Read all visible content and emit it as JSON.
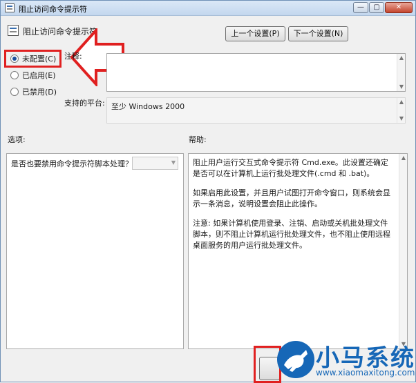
{
  "window": {
    "title": "阻止访问命令提示符"
  },
  "header": {
    "policy_title": "阻止访问命令提示符",
    "prev_button": "上一个设置(P)",
    "next_button": "下一个设置(N)"
  },
  "state": {
    "options": [
      {
        "label": "未配置(C)",
        "checked": true
      },
      {
        "label": "已启用(E)",
        "checked": false
      },
      {
        "label": "已禁用(D)",
        "checked": false
      }
    ]
  },
  "comment": {
    "label": "注释:",
    "value": ""
  },
  "platform": {
    "label": "支持的平台:",
    "value": "至少 Windows 2000"
  },
  "sections": {
    "options_label": "选项:",
    "help_label": "帮助:"
  },
  "options_panel": {
    "question": "是否也要禁用命令提示符脚本处理？",
    "selected": ""
  },
  "help": {
    "paragraphs": [
      "阻止用户运行交互式命令提示符 Cmd.exe。此设置还确定是否可以在计算机上运行批处理文件(.cmd 和 .bat)。",
      "如果启用此设置，并且用户试图打开命令窗口，则系统会显示一条消息，说明设置会阻止此操作。",
      "注意: 如果计算机使用登录、注销、启动或关机批处理文件脚本，则不阻止计算机运行批处理文件，也不阻止使用远程桌面服务的用户运行批处理文件。"
    ]
  },
  "watermark": {
    "brand": "小马系统",
    "url": "www.xiaomaxitong.com"
  },
  "colors": {
    "highlight": "#e02020",
    "brand": "#1667b7"
  },
  "icons": {
    "window": "policy-icon",
    "arrow": "left-arrow-annotation"
  }
}
